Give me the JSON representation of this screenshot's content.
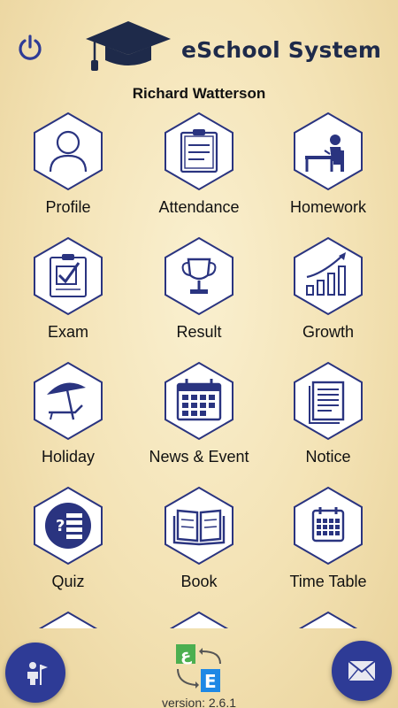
{
  "header": {
    "app_title": "eSchool System",
    "power_icon": "power-icon",
    "logo_icon": "graduation-cap-icon"
  },
  "user": {
    "name": "Richard Watterson"
  },
  "menu": {
    "items": [
      {
        "label": "Profile",
        "icon": "profile-icon"
      },
      {
        "label": "Attendance",
        "icon": "attendance-icon"
      },
      {
        "label": "Homework",
        "icon": "homework-icon"
      },
      {
        "label": "Exam",
        "icon": "exam-icon"
      },
      {
        "label": "Result",
        "icon": "trophy-icon"
      },
      {
        "label": "Growth",
        "icon": "growth-chart-icon"
      },
      {
        "label": "Holiday",
        "icon": "beach-umbrella-icon"
      },
      {
        "label": "News & Event",
        "icon": "calendar-icon"
      },
      {
        "label": "Notice",
        "icon": "notice-icon"
      },
      {
        "label": "Quiz",
        "icon": "quiz-icon"
      },
      {
        "label": "Book",
        "icon": "book-icon"
      },
      {
        "label": "Time Table",
        "icon": "timetable-icon"
      }
    ]
  },
  "footer": {
    "version": "version: 2.6.1",
    "left_fab_icon": "person-flag-icon",
    "right_fab_icon": "mail-icon",
    "brand_icon": "e-learning-logo-icon"
  },
  "colors": {
    "accent": "#2e3b96",
    "icon_stroke": "#2a3480",
    "hex_fill": "#ffffff",
    "background": "#f3e2b4"
  }
}
